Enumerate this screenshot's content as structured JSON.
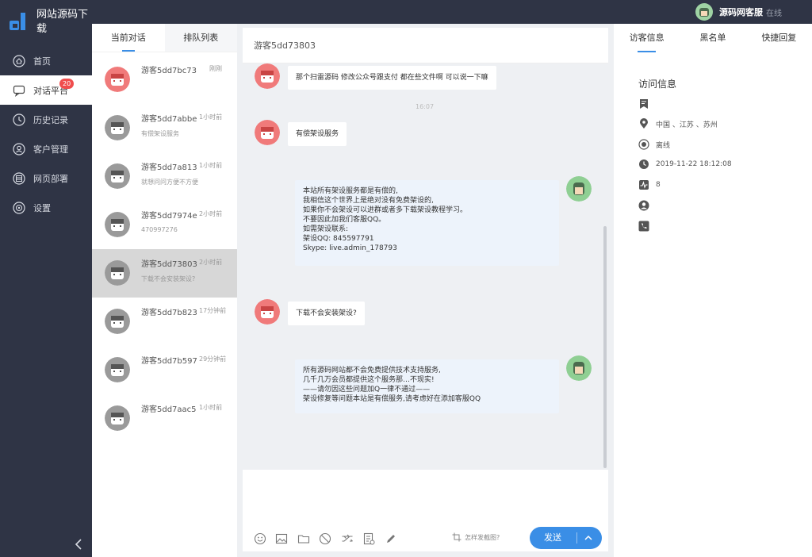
{
  "app": {
    "logo_text": "网站源码下载"
  },
  "header": {
    "agent_name": "源码网客服",
    "agent_status": "在线"
  },
  "sidebar": {
    "items": [
      {
        "label": "首页",
        "icon": "home-icon"
      },
      {
        "label": "对话平台",
        "icon": "chat-icon",
        "badge": "20"
      },
      {
        "label": "历史记录",
        "icon": "history-icon"
      },
      {
        "label": "客户管理",
        "icon": "user-icon"
      },
      {
        "label": "网页部署",
        "icon": "web-icon"
      },
      {
        "label": "设置",
        "icon": "settings-icon"
      }
    ]
  },
  "conversations": {
    "tabs": [
      "当前对话",
      "排队列表"
    ],
    "items": [
      {
        "name": "游客5dd7bc73",
        "time": "刚刚",
        "preview": ""
      },
      {
        "name": "游客5dd7abbe",
        "time": "1小时前",
        "preview": "有偿架设服务"
      },
      {
        "name": "游客5dd7a813",
        "time": "1小时前",
        "preview": "就想问问方便不方便"
      },
      {
        "name": "游客5dd7974e",
        "time": "2小时前",
        "preview": "470997276"
      },
      {
        "name": "游客5dd73803",
        "time": "2小时前",
        "preview": "下载不会安装架设?"
      },
      {
        "name": "游客5dd7b823",
        "time": "17分钟前",
        "preview": ""
      },
      {
        "name": "游客5dd7b597",
        "time": "29分钟前",
        "preview": ""
      },
      {
        "name": "游客5dd7aac5",
        "time": "1小时前",
        "preview": ""
      }
    ]
  },
  "chat": {
    "title": "游客5dd73803",
    "timestamp": "16:07",
    "messages": [
      {
        "side": "left",
        "lines": [
          "那个扫雷源码 修改公众号跟支付 都在些文件啊 可以说一下嘛"
        ]
      },
      {
        "side": "left",
        "lines": [
          "有偿架设服务"
        ]
      },
      {
        "side": "right",
        "lines": [
          "本站所有架设服务都是有偿的,",
          "我相信这个世界上是绝对没有免费架设的,",
          "如果你不会架设可以进群或者多下载架设教程学习。",
          "不要因此加我们客服QQ。",
          "如需架设联系:",
          "架设QQ: 845597791",
          "Skype: live.admin_178793"
        ]
      },
      {
        "side": "left",
        "lines": [
          "下载不会安装架设?"
        ]
      },
      {
        "side": "right",
        "lines": [
          "所有源码网站都不会免费提供技术支持服务,",
          "几千几万会员都提供这个服务那…不现实!",
          "——请勿因这些问题加Q一律不通过——",
          "架设修复等问题本站是有偿服务,请考虑好在添加客服QQ"
        ]
      }
    ],
    "screenshot_tip": "怎样发截图?",
    "send_label": "发送",
    "tool_icons": [
      "emoji-icon",
      "image-icon",
      "folder-icon",
      "ban-icon",
      "transfer-icon",
      "note-icon",
      "pen-icon"
    ]
  },
  "info": {
    "tabs": [
      "访客信息",
      "黑名单",
      "快捷回复"
    ],
    "title": "访问信息",
    "rows": [
      {
        "icon": "bookmark-icon",
        "value": ""
      },
      {
        "icon": "location-icon",
        "value": "中国 、江苏 、苏州"
      },
      {
        "icon": "status-icon",
        "value": "离线"
      },
      {
        "icon": "clock-icon",
        "value": "2019-11-22 18:12:08"
      },
      {
        "icon": "activity-icon",
        "value": "8"
      },
      {
        "icon": "person-icon",
        "value": ""
      },
      {
        "icon": "phone-icon",
        "value": ""
      }
    ]
  },
  "colors": {
    "sidebar_bg": "#2f3445",
    "accent": "#3a8ee6",
    "badge": "#f04d4d",
    "avatar_red": "#f07a7a",
    "avatar_gray": "#9a9a9a",
    "avatar_green": "#8fcf93"
  }
}
